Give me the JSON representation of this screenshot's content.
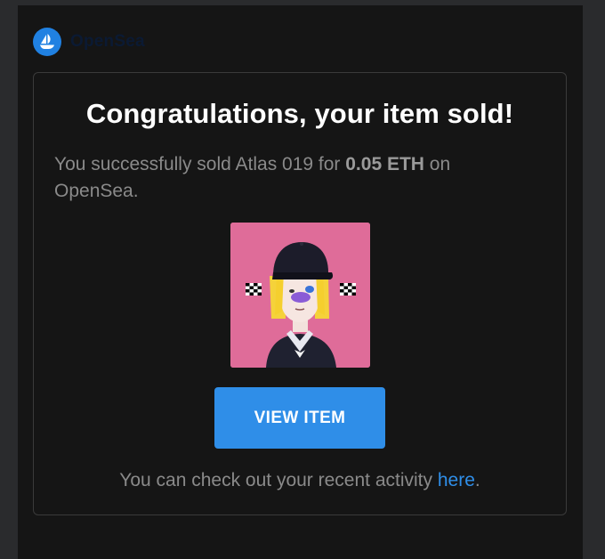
{
  "brand": {
    "name": "OpenSea",
    "accent": "#2081e2"
  },
  "email": {
    "title": "Congratulations, your item sold!",
    "desc_prefix": "You successfully sold Atlas 019 for ",
    "desc_amount": "0.05 ETH",
    "desc_suffix": " on OpenSea.",
    "image_icon": "nft-artwork-icon",
    "button_label": "VIEW ITEM",
    "button_color": "#2f8ee8",
    "footer_prefix": "You can check out your recent activity ",
    "footer_link": "here",
    "footer_suffix": "."
  }
}
